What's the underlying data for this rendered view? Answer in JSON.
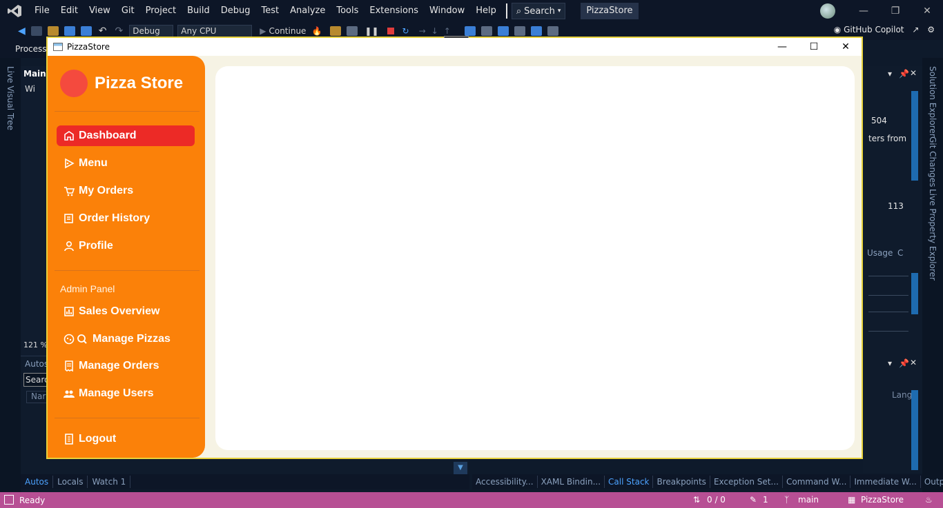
{
  "vs": {
    "menu": [
      "File",
      "Edit",
      "View",
      "Git",
      "Project",
      "Build",
      "Debug",
      "Test",
      "Analyze",
      "Tools",
      "Extensions",
      "Window",
      "Help"
    ],
    "search_label": "Search",
    "solution_name": "PizzaStore",
    "toolbar": {
      "config": "Debug",
      "platform": "Any CPU",
      "continue_label": "Continue",
      "copilot_label": "GitHub Copilot"
    },
    "process_label": "Process:",
    "left_vertical_tab": "Live Visual Tree",
    "right_vertical_tabs": [
      "Solution Explorer",
      "Git Changes",
      "Live Property Explorer"
    ],
    "left_panel_tab": "Main\\",
    "left_panel_sub": "Wi",
    "zoom": "121 %",
    "autos_panel": {
      "title": "Autos",
      "search": "Searc",
      "col": "Nar"
    },
    "right_panel": {
      "val1": "504",
      "text1": "ters from",
      "val2": "113",
      "usage": "Usage",
      "c": "C",
      "lang": "Lang"
    },
    "bottom_tabs_left": [
      "Autos",
      "Locals",
      "Watch 1"
    ],
    "bottom_tabs_right": [
      "Accessibility...",
      "XAML Bindin...",
      "Call Stack",
      "Breakpoints",
      "Exception Set...",
      "Command W...",
      "Immediate W...",
      "Output"
    ],
    "status": {
      "ready": "Ready",
      "counts": "0 / 0",
      "edits": "1",
      "branch": "main",
      "repo": "PizzaStore"
    },
    "colors": {
      "status_bar": "#b74f94",
      "sidebar": "#fb8109",
      "active_nav": "#ec2a26",
      "logo": "#f44a3e"
    }
  },
  "app": {
    "window_title": "PizzaStore",
    "brand": "Pizza Store",
    "nav": [
      {
        "label": "Dashboard",
        "icon": "store-icon"
      },
      {
        "label": "Menu",
        "icon": "pizza-slice-icon"
      },
      {
        "label": "My Orders",
        "icon": "cart-icon"
      },
      {
        "label": "Order History",
        "icon": "history-icon"
      },
      {
        "label": "Profile",
        "icon": "user-icon"
      }
    ],
    "admin_label": "Admin Panel",
    "admin_nav": [
      {
        "label": "Sales Overview",
        "icon": "chart-icon"
      },
      {
        "label": "Manage Pizzas",
        "icon": "pizza-search-icon"
      },
      {
        "label": "Manage Orders",
        "icon": "receipt-icon"
      },
      {
        "label": "Manage Users",
        "icon": "users-icon"
      }
    ],
    "logout_label": "Logout"
  }
}
